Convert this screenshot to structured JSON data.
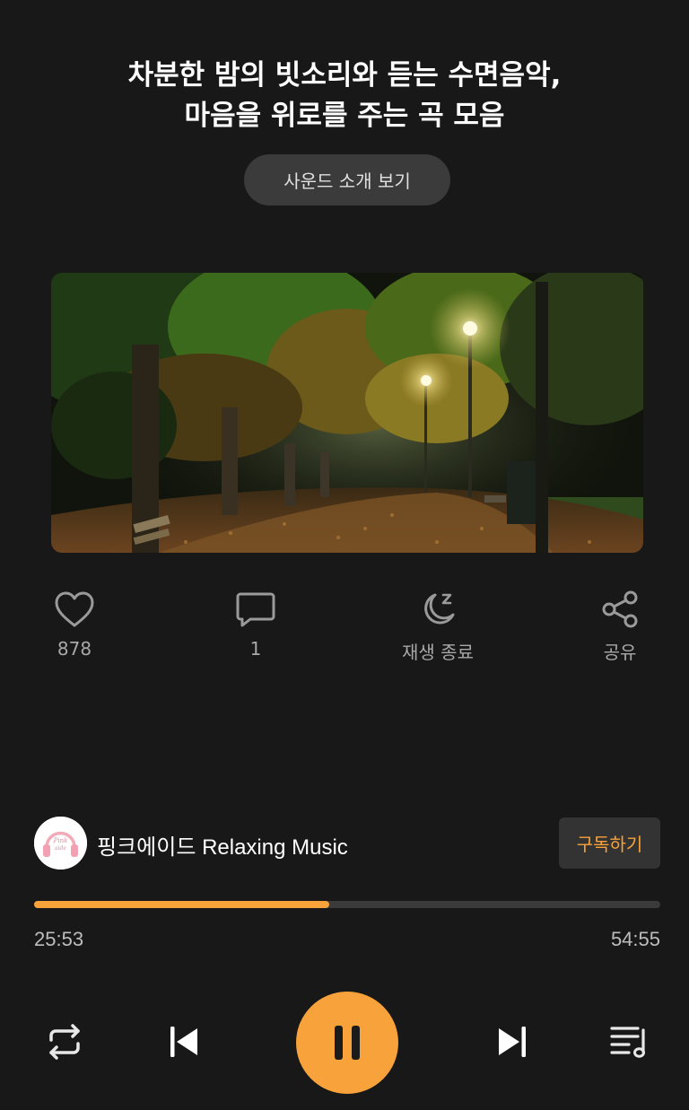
{
  "title": {
    "line1": "차분한 밤의 빗소리와 듣는 수면음악,",
    "line2": "마음을 위로를 주는 곡 모음"
  },
  "intro_button": "사운드 소개 보기",
  "cover": {
    "icon": "night-park-image"
  },
  "actions": {
    "like_count": "878",
    "comment_count": "1",
    "sleep_timer_label": "재생 종료",
    "share_label": "공유"
  },
  "channel": {
    "name": "핑크에이드 Relaxing Music",
    "avatar_text": "Pink aide",
    "subscribe_label": "구독하기"
  },
  "player": {
    "elapsed": "25:53",
    "duration": "54:55",
    "progress_fraction": 0.4715,
    "accent_color": "#f7a23b"
  }
}
